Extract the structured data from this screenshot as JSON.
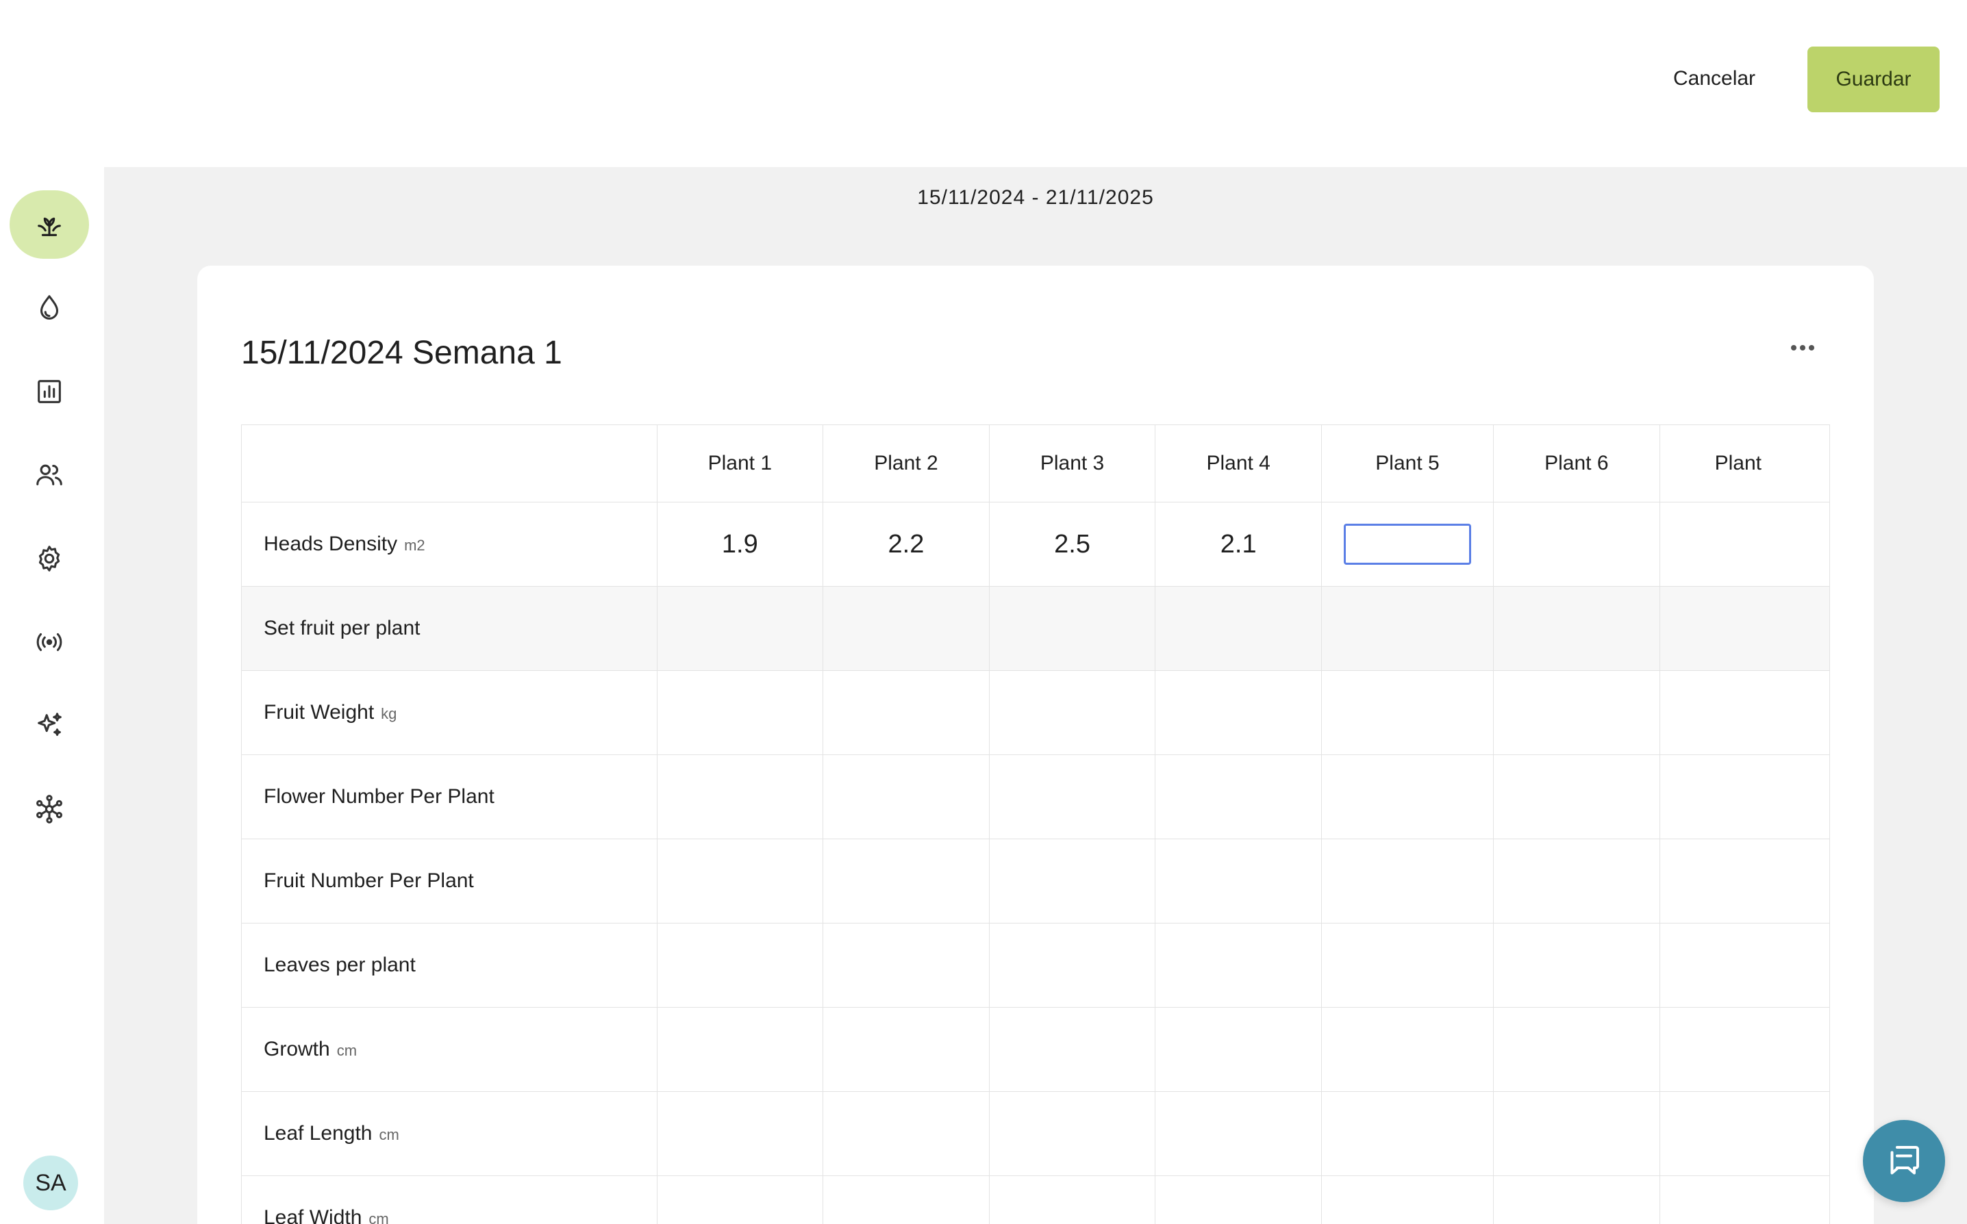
{
  "header": {
    "cancel_label": "Cancelar",
    "save_label": "Guardar"
  },
  "sidebar": {
    "items": [
      {
        "name": "plant-icon",
        "active": true
      },
      {
        "name": "water-drop-icon",
        "active": false
      },
      {
        "name": "bar-chart-icon",
        "active": false
      },
      {
        "name": "users-icon",
        "active": false
      },
      {
        "name": "gear-icon",
        "active": false
      },
      {
        "name": "broadcast-icon",
        "active": false
      },
      {
        "name": "sparkles-icon",
        "active": false
      },
      {
        "name": "network-icon",
        "active": false
      }
    ],
    "avatar_initials": "SA",
    "active_color": "#d8eaad"
  },
  "main": {
    "date_range": "15/11/2024 - 21/11/2025",
    "card_title": "15/11/2024 Semana 1",
    "columns": [
      "Plant 1",
      "Plant 2",
      "Plant 3",
      "Plant 4",
      "Plant 5",
      "Plant 6",
      "Plant"
    ],
    "rows": [
      {
        "label": "Heads Density",
        "unit": "m2",
        "values": [
          "1.9",
          "2.2",
          "2.5",
          "2.1",
          "",
          "",
          ""
        ]
      },
      {
        "label": "Set fruit per plant",
        "unit": "",
        "values": [
          "",
          "",
          "",
          "",
          "",
          "",
          ""
        ]
      },
      {
        "label": "Fruit Weight",
        "unit": "kg",
        "values": [
          "",
          "",
          "",
          "",
          "",
          "",
          ""
        ]
      },
      {
        "label": "Flower Number Per Plant",
        "unit": "",
        "values": [
          "",
          "",
          "",
          "",
          "",
          "",
          ""
        ]
      },
      {
        "label": "Fruit Number Per Plant",
        "unit": "",
        "values": [
          "",
          "",
          "",
          "",
          "",
          "",
          ""
        ]
      },
      {
        "label": "Leaves per plant",
        "unit": "",
        "values": [
          "",
          "",
          "",
          "",
          "",
          "",
          ""
        ]
      },
      {
        "label": "Growth",
        "unit": "cm",
        "values": [
          "",
          "",
          "",
          "",
          "",
          "",
          ""
        ]
      },
      {
        "label": "Leaf Length",
        "unit": "cm",
        "values": [
          "",
          "",
          "",
          "",
          "",
          "",
          ""
        ]
      },
      {
        "label": "Leaf Width",
        "unit": "cm",
        "values": [
          "",
          "",
          "",
          "",
          "",
          "",
          ""
        ]
      }
    ],
    "active_input": {
      "row": 0,
      "col": 4,
      "value": ""
    }
  },
  "colors": {
    "save_button": "#bcd36a",
    "chat_button": "#3f8da9",
    "input_focus": "#5b7fe6"
  }
}
